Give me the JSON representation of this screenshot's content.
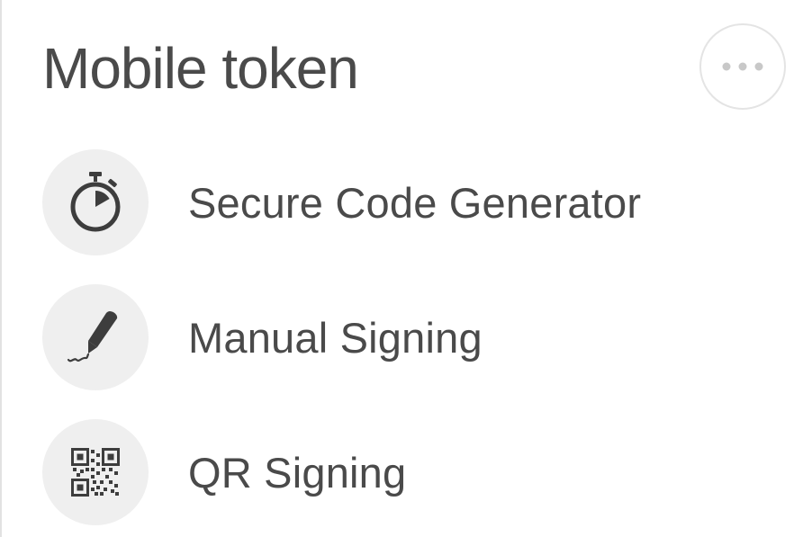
{
  "header": {
    "title": "Mobile token",
    "more_icon": "more-horizontal-icon"
  },
  "menu": {
    "items": [
      {
        "label": "Secure Code Generator",
        "icon": "stopwatch-icon"
      },
      {
        "label": "Manual Signing",
        "icon": "pen-icon"
      },
      {
        "label": "QR Signing",
        "icon": "qr-code-icon"
      }
    ]
  },
  "colors": {
    "text": "#4a4a4a",
    "icon_background": "#efefef",
    "icon_glyph": "#3d3d3d",
    "more_border": "#e4e4e4",
    "more_dots": "#c8c8c8"
  }
}
